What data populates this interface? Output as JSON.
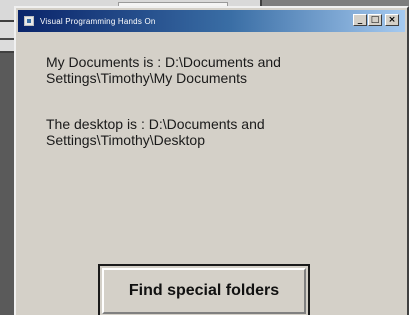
{
  "window": {
    "title": "Visual Programming Hands On",
    "minimize_label": "_",
    "maximize_label": "□",
    "close_label": "×"
  },
  "main": {
    "my_documents_text": "My Documents is : D:\\Documents and Settings\\Timothy\\My Documents",
    "desktop_text": "The desktop is : D:\\Documents and Settings\\Timothy\\Desktop",
    "find_button_label": "Find special folders"
  },
  "colors": {
    "titlebar_start": "#0a246a",
    "titlebar_end": "#a6caf0",
    "window_face": "#d4d0c8"
  }
}
